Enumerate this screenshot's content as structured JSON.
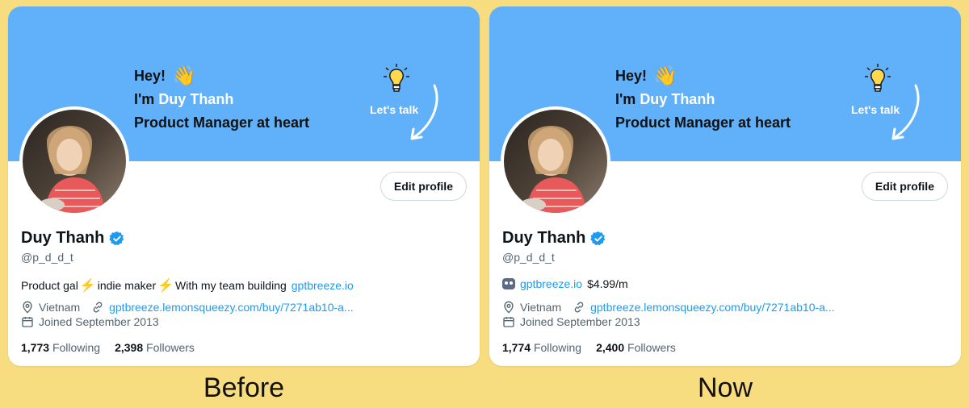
{
  "before": {
    "caption": "Before",
    "banner": {
      "hey": "Hey!",
      "im_prefix": "I'm",
      "name": "Duy Thanh",
      "tagline": "Product Manager at heart",
      "lets_talk": "Let's talk"
    },
    "edit_profile": "Edit profile",
    "display_name": "Duy Thanh",
    "handle": "@p_d_d_t",
    "bio": {
      "part1": "Product gal",
      "part2": "indie maker",
      "part3": "With my team building",
      "link": "gptbreeze.io"
    },
    "location": "Vietnam",
    "website": "gptbreeze.lemonsqueezy.com/buy/7271ab10-a...",
    "joined": "Joined September 2013",
    "following_count": "1,773",
    "following_label": "Following",
    "followers_count": "2,398",
    "followers_label": "Followers"
  },
  "now": {
    "caption": "Now",
    "banner": {
      "hey": "Hey!",
      "im_prefix": "I'm",
      "name": "Duy Thanh",
      "tagline": "Product Manager at heart",
      "lets_talk": "Let's talk"
    },
    "edit_profile": "Edit profile",
    "display_name": "Duy Thanh",
    "handle": "@p_d_d_t",
    "bio": {
      "link": "gptbreeze.io",
      "price": "$4.99/m"
    },
    "location": "Vietnam",
    "website": "gptbreeze.lemonsqueezy.com/buy/7271ab10-a...",
    "joined": "Joined September 2013",
    "following_count": "1,774",
    "following_label": "Following",
    "followers_count": "2,400",
    "followers_label": "Followers"
  },
  "colors": {
    "page_bg": "#F8DD80",
    "banner_bg": "#60B1FA",
    "link": "#1D9BF0",
    "verified": "#1D9BF0"
  }
}
